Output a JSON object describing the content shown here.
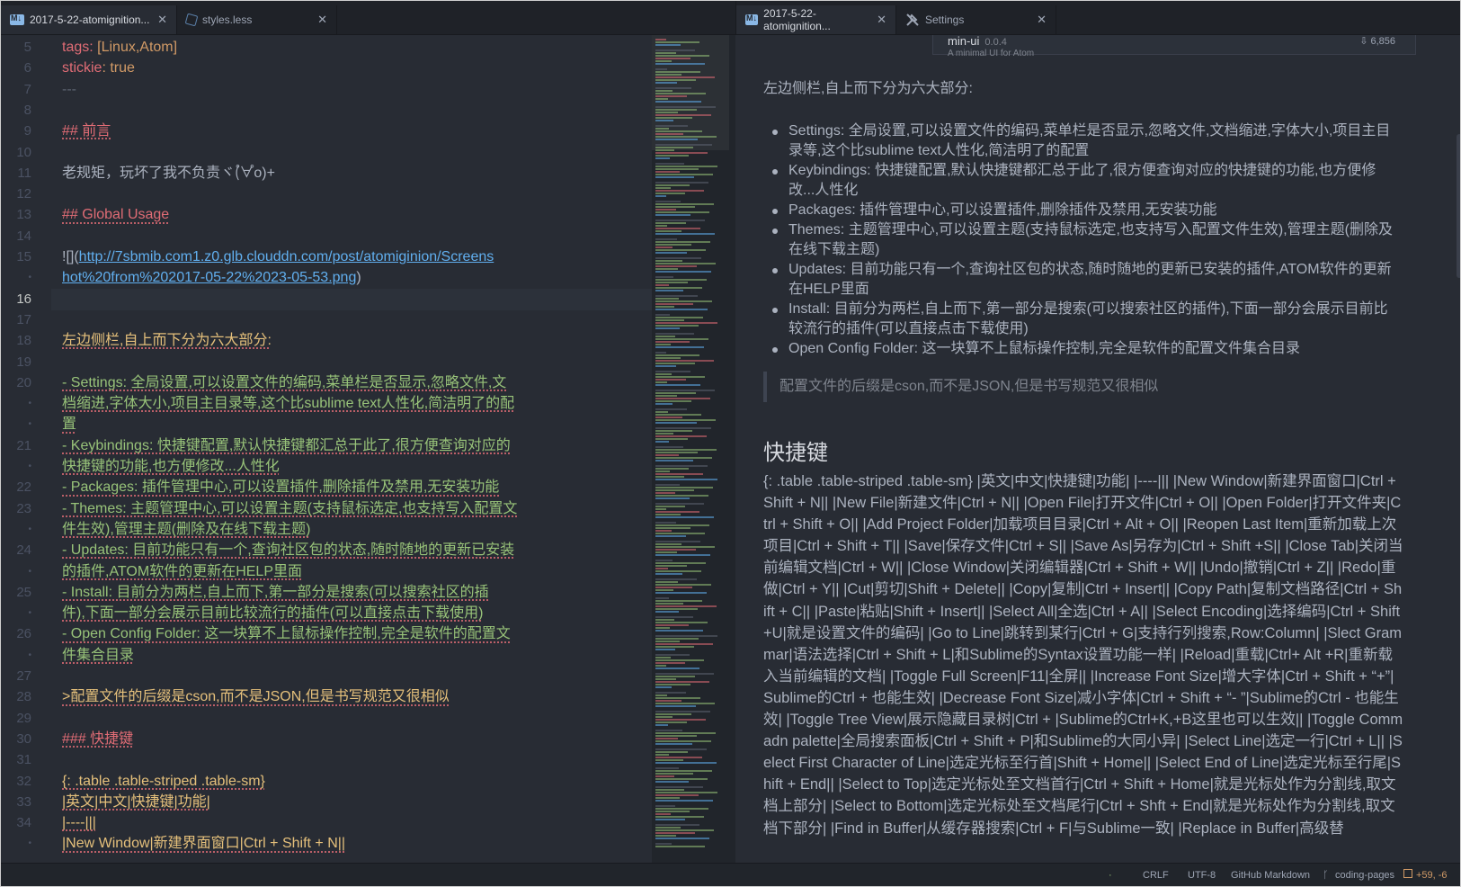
{
  "tabs_left": [
    {
      "label": "2017-5-22-atomignition...",
      "icon": "markdown-icon",
      "active": true
    },
    {
      "label": "styles.less",
      "icon": "less-file-icon",
      "active": false
    }
  ],
  "tabs_right": [
    {
      "label": "2017-5-22-atomignition...",
      "icon": "markdown-icon",
      "active": true
    },
    {
      "label": "Settings",
      "icon": "tools-icon",
      "active": false
    }
  ],
  "editor": {
    "lines": [
      {
        "num": "5",
        "segments": [
          {
            "t": "tags: ",
            "c": "t-key"
          },
          {
            "t": "[Linux,Atom]",
            "c": "t-val"
          }
        ]
      },
      {
        "num": "6",
        "segments": [
          {
            "t": "stickie",
            "c": "t-key"
          },
          {
            "t": ": true",
            "c": "t-val"
          }
        ]
      },
      {
        "num": "7",
        "segments": [
          {
            "t": "---",
            "c": "t-dim"
          }
        ]
      },
      {
        "num": "8",
        "segments": []
      },
      {
        "num": "9",
        "segments": [
          {
            "t": "## 前言",
            "c": "t-head"
          }
        ]
      },
      {
        "num": "10",
        "segments": []
      },
      {
        "num": "11",
        "segments": [
          {
            "t": "老规矩，玩坏了我不负责ヾ(゚∀゚o)+",
            "c": "t-plain"
          }
        ]
      },
      {
        "num": "12",
        "segments": []
      },
      {
        "num": "13",
        "segments": [
          {
            "t": "## Global Usage",
            "c": "t-head"
          }
        ]
      },
      {
        "num": "14",
        "segments": []
      },
      {
        "num": "15",
        "segments": [
          {
            "t": "![](",
            "c": "t-plain"
          },
          {
            "t": "http://7sbmib.com1.z0.glb.clouddn.com/post/atomiginion/Screens",
            "c": "t-link"
          }
        ]
      },
      {
        "num": "•",
        "segments": [
          {
            "t": "hot%20from%202017-05-22%2023-05-53.png",
            "c": "t-link"
          },
          {
            "t": ")",
            "c": "t-plain"
          }
        ]
      },
      {
        "num": "16",
        "segments": [],
        "current": true
      },
      {
        "num": "17",
        "segments": []
      },
      {
        "num": "18",
        "segments": [
          {
            "t": "左边侧栏,自上而下分为六大部分:",
            "c": "t-yel"
          }
        ]
      },
      {
        "num": "19",
        "segments": []
      },
      {
        "num": "20",
        "segments": [
          {
            "t": "- Settings: 全局设置,可以设置文件的编码,菜单栏是否显示,忽略文件,文",
            "c": "t-text"
          }
        ]
      },
      {
        "num": "•",
        "segments": [
          {
            "t": "档缩进,字体大小,项目主目录等,这个比sublime text人性化,简洁明了的配",
            "c": "t-text"
          }
        ]
      },
      {
        "num": "•",
        "segments": [
          {
            "t": "置",
            "c": "t-text"
          }
        ]
      },
      {
        "num": "21",
        "segments": [
          {
            "t": "- Keybindings: 快捷键配置,默认快捷键都汇总于此了,很方便查询对应的",
            "c": "t-text"
          }
        ]
      },
      {
        "num": "•",
        "segments": [
          {
            "t": "快捷键的功能,也方便修改...人性化",
            "c": "t-text"
          }
        ]
      },
      {
        "num": "22",
        "segments": [
          {
            "t": "- Packages: 插件管理中心,可以设置插件,删除插件及禁用,无安装功能",
            "c": "t-text"
          }
        ]
      },
      {
        "num": "23",
        "segments": [
          {
            "t": "- Themes: 主题管理中心,可以设置主题(支持鼠标选定,也支持写入配置文",
            "c": "t-text"
          }
        ]
      },
      {
        "num": "•",
        "segments": [
          {
            "t": "件生效),管理主题(删除及在线下载主题)",
            "c": "t-text"
          }
        ]
      },
      {
        "num": "24",
        "segments": [
          {
            "t": "- Updates: 目前功能只有一个,查询社区包的状态,随时随地的更新已安装",
            "c": "t-text"
          }
        ]
      },
      {
        "num": "•",
        "segments": [
          {
            "t": "的插件,ATOM软件的更新在HELP里面",
            "c": "t-text"
          }
        ]
      },
      {
        "num": "25",
        "segments": [
          {
            "t": "- Install: 目前分为两栏,自上而下,第一部分是搜索(可以搜索社区的插",
            "c": "t-text"
          }
        ]
      },
      {
        "num": "•",
        "segments": [
          {
            "t": "件),下面一部分会展示目前比较流行的插件(可以直接点击下载使用)",
            "c": "t-text"
          }
        ]
      },
      {
        "num": "26",
        "segments": [
          {
            "t": "- Open Config Folder: 这一块算不上鼠标操作控制,完全是软件的配置文",
            "c": "t-text"
          }
        ]
      },
      {
        "num": "•",
        "segments": [
          {
            "t": "件集合目录",
            "c": "t-text"
          }
        ]
      },
      {
        "num": "27",
        "segments": []
      },
      {
        "num": "28",
        "segments": [
          {
            "t": ">配置文件的后缀是cson,而不是JSON,但是书写规范又很相似",
            "c": "t-yel"
          }
        ]
      },
      {
        "num": "29",
        "segments": []
      },
      {
        "num": "30",
        "segments": [
          {
            "t": "### 快捷键",
            "c": "t-head"
          }
        ]
      },
      {
        "num": "31",
        "segments": []
      },
      {
        "num": "32",
        "segments": [
          {
            "t": "{: .table .table-striped .table-sm}",
            "c": "t-yel"
          }
        ]
      },
      {
        "num": "33",
        "segments": [
          {
            "t": "|英文|中文|快捷键|功能|",
            "c": "t-yel"
          }
        ]
      },
      {
        "num": "34",
        "segments": [
          {
            "t": "|----|||",
            "c": "t-yel"
          }
        ]
      },
      {
        "num": "•",
        "segments": [
          {
            "t": "|New Window|新建界面窗口|Ctrl + Shift + N||",
            "c": "t-yel"
          }
        ]
      }
    ]
  },
  "preview": {
    "package_card": {
      "name": "min-ui",
      "version": "0.0.4",
      "downloads": "6,856",
      "description": "A minimal UI for Atom"
    },
    "intro": "左边侧栏,自上而下分为六大部分:",
    "list": [
      "Settings: 全局设置,可以设置文件的编码,菜单栏是否显示,忽略文件,文档缩进,字体大小,项目主目录等,这个比sublime text人性化,简洁明了的配置",
      "Keybindings: 快捷键配置,默认快捷键都汇总于此了,很方便查询对应的快捷键的功能,也方便修改...人性化",
      "Packages: 插件管理中心,可以设置插件,删除插件及禁用,无安装功能",
      "Themes: 主题管理中心,可以设置主题(支持鼠标选定,也支持写入配置文件生效),管理主题(删除及在线下载主题)",
      "Updates: 目前功能只有一个,查询社区包的状态,随时随地的更新已安装的插件,ATOM软件的更新在HELP里面",
      "Install: 目前分为两栏,自上而下,第一部分是搜索(可以搜索社区的插件),下面一部分会展示目前比较流行的插件(可以直接点击下载使用)",
      "Open Config Folder: 这一块算不上鼠标操作控制,完全是软件的配置文件集合目录"
    ],
    "blockquote": "配置文件的后缀是cson,而不是JSON,但是书写规范又很相似",
    "heading": "快捷键",
    "paragraph": "{: .table .table-striped .table-sm} |英文|中文|快捷键|功能| |----||| |New Window|新建界面窗口|Ctrl + Shift + N|| |New File|新建文件|Ctrl + N|| |Open File|打开文件|Ctrl + O|| |Open Folder|打开文件夹|Ctrl + Shift + O|| |Add Project Folder|加载项目目录|Ctrl + Alt + O|| |Reopen Last Item|重新加载上次项目|Ctrl + Shift + T|| |Save|保存文件|Ctrl + S|| |Save As|另存为|Ctrl + Shift +S|| |Close Tab|关闭当前编辑文档|Ctrl + W|| |Close Window|关闭编辑器|Ctrl + Shift + W|| |Undo|撤销|Ctrl + Z|| |Redo|重做|Ctrl + Y|| |Cut|剪切|Shift + Delete|| |Copy|复制|Ctrl + Insert|| |Copy Path|复制文档路径|Ctrl + Shift + C|| |Paste|粘贴|Shift + Insert|| |Select All|全选|Ctrl + A|| |Select Encoding|选择编码|Ctrl + Shift +U|就是设置文件的编码| |Go to Line|跳转到某行|Ctrl + G|支持行列搜索,Row:Column| |Slect Grammar|语法选择|Ctrl + Shift + L|和Sublime的Syntax设置功能一样| |Reload|重载|Ctrl+ Alt +R|重新载入当前编辑的文档| |Toggle Full Screen|F11|全屏|| |Increase Font Size|增大字体|Ctrl + Shift + “+”|Sublime的Ctrl + 也能生效| |Decrease Font Size|减小字体|Ctrl + Shift + “- ”|Sublime的Ctrl - 也能生效| |Toggle Tree View|展示隐藏目录树|Ctrl + |Sublime的Ctrl+K,+B这里也可以生效|| |Toggle Commadn palette|全局搜索面板|Ctrl + Shift + P|和Sublime的大同小异| |Select Line|选定一行|Ctrl + L|| |Select First Character of Line|选定光标至行首|Shift + Home|| |Select End of Line|选定光标至行尾|Shift + End|| |Select to Top|选定光标处至文档首行|Ctrl + Shift + Home|就是光标处作为分割线,取文档上部分| |Select to Bottom|选定光标处至文档尾行|Ctrl + Shft + End|就是光标处作为分割线,取文档下部分| |Find in Buffer|从缓存器搜索|Ctrl + F|与Sublime一致| |Replace in Buffer|高级替"
  },
  "statusbar": {
    "line_ending": "CRLF",
    "encoding": "UTF-8",
    "grammar": "GitHub Markdown",
    "branch": "coding-pages",
    "git_diff": "+59, -6"
  }
}
